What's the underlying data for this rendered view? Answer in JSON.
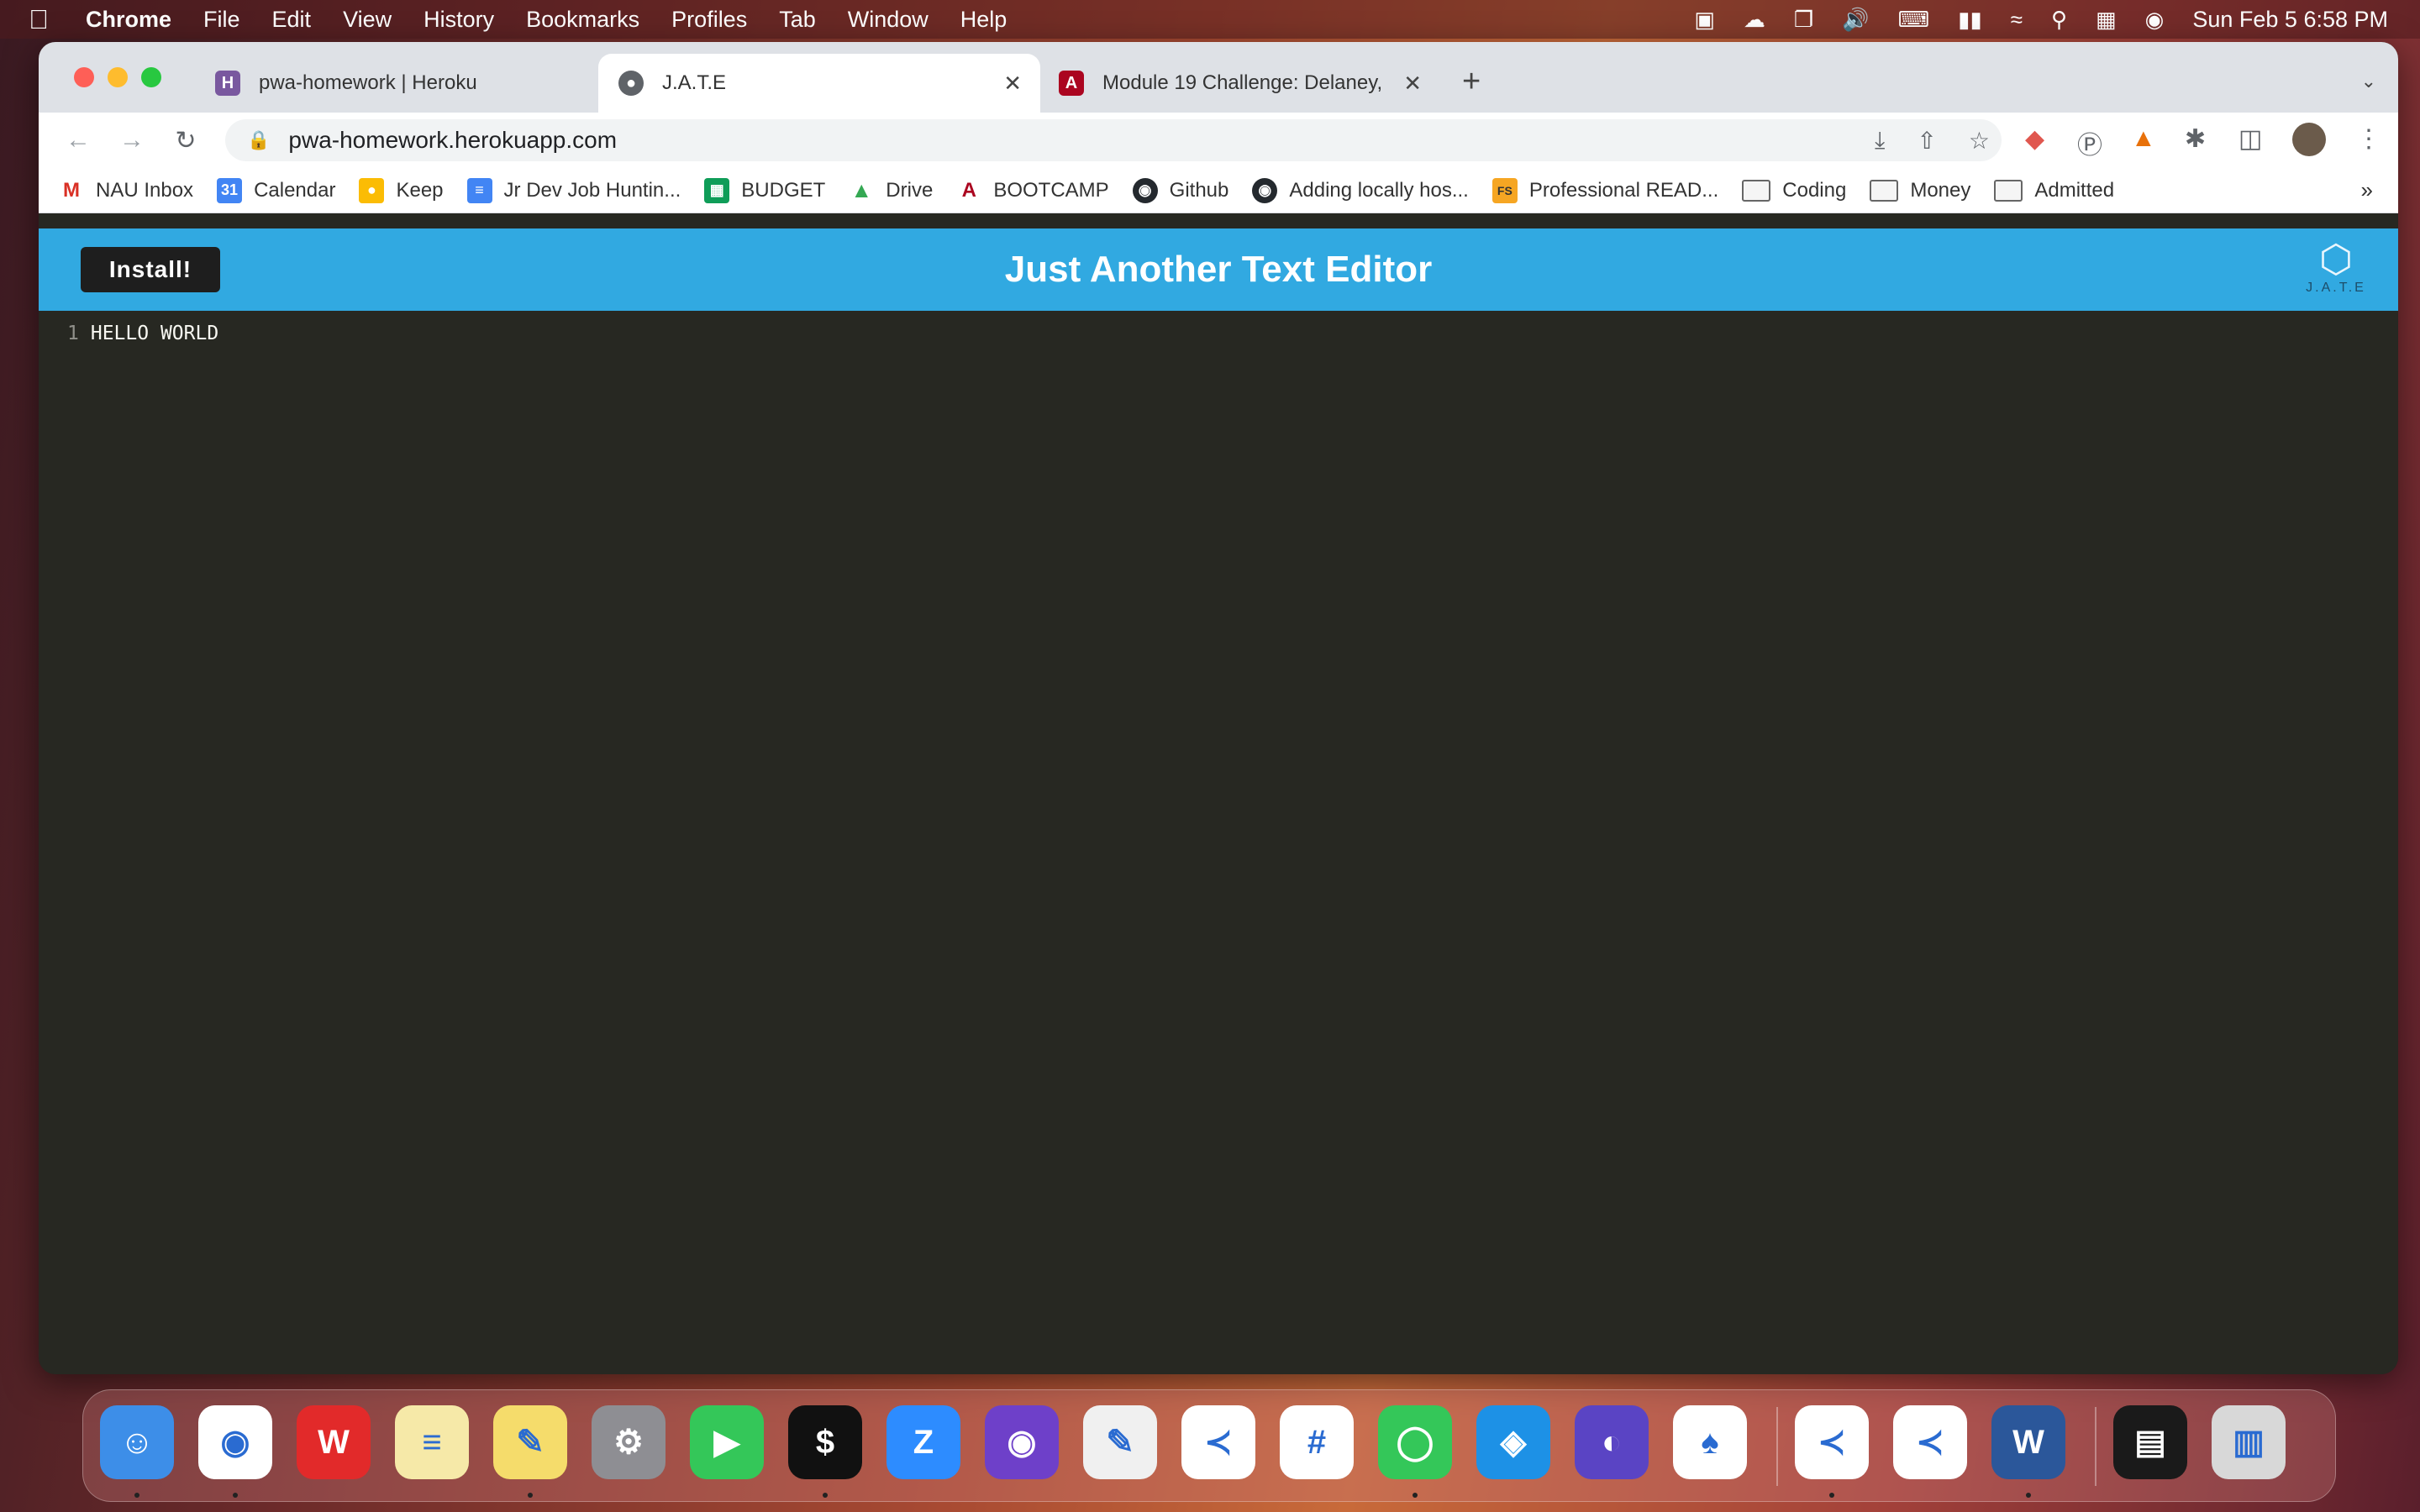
{
  "menubar": {
    "app": "Chrome",
    "items": [
      "File",
      "Edit",
      "View",
      "History",
      "Bookmarks",
      "Profiles",
      "Tab",
      "Window",
      "Help"
    ],
    "clock": "Sun Feb 5  6:58 PM"
  },
  "tabs": [
    {
      "title": "pwa-homework | Heroku",
      "icon": "heroku-icon"
    },
    {
      "title": "J.A.T.E",
      "icon": "globe-icon"
    },
    {
      "title": "Module 19 Challenge: Delaney,",
      "icon": "arizona-icon"
    }
  ],
  "address": {
    "url": "pwa-homework.herokuapp.com"
  },
  "bookmarks": [
    {
      "label": "NAU Inbox",
      "icon": "gmail-icon",
      "color": "#ffffff"
    },
    {
      "label": "Calendar",
      "icon": "calendar-icon",
      "color": "#4285f4"
    },
    {
      "label": "Keep",
      "icon": "keep-icon",
      "color": "#fbbc04"
    },
    {
      "label": "Jr Dev Job Huntin...",
      "icon": "docs-icon",
      "color": "#4285f4"
    },
    {
      "label": "BUDGET",
      "icon": "sheets-icon",
      "color": "#0f9d58"
    },
    {
      "label": "Drive",
      "icon": "drive-icon",
      "color": "#34a853"
    },
    {
      "label": "BOOTCAMP",
      "icon": "arizona-icon",
      "color": "#ab0520"
    },
    {
      "label": "Github",
      "icon": "github-icon",
      "color": "#24292e"
    },
    {
      "label": "Adding locally hos...",
      "icon": "github-icon",
      "color": "#24292e"
    },
    {
      "label": "Professional READ...",
      "icon": "fs-icon",
      "color": "#f6a623"
    },
    {
      "label": "Coding",
      "icon": "folder-icon",
      "color": ""
    },
    {
      "label": "Money",
      "icon": "folder-icon",
      "color": ""
    },
    {
      "label": "Admitted",
      "icon": "folder-icon",
      "color": ""
    }
  ],
  "app": {
    "install_label": "Install!",
    "title": "Just Another Text Editor",
    "logo_text": "J.A.T.E",
    "editor_line_number": "1",
    "editor_line_text": "HELLO WORLD"
  },
  "colors": {
    "header": "#31a9e1",
    "editor_bg": "#272822"
  },
  "dock": [
    {
      "name": "finder-icon",
      "color": "#3d8ee8"
    },
    {
      "name": "chrome-icon",
      "color": "#ffffff"
    },
    {
      "name": "wps-icon",
      "color": "#e22a2a"
    },
    {
      "name": "notes-icon",
      "color": "#f6e9a8"
    },
    {
      "name": "stickies-icon",
      "color": "#f5dc6b"
    },
    {
      "name": "system-preferences-icon",
      "color": "#8e8e93"
    },
    {
      "name": "facetime-icon",
      "color": "#34c759"
    },
    {
      "name": "terminal-icon",
      "color": "#111111"
    },
    {
      "name": "zoom-icon",
      "color": "#2d8cff"
    },
    {
      "name": "github-desktop-icon",
      "color": "#6e40c9"
    },
    {
      "name": "textedit-icon",
      "color": "#f0f0f0"
    },
    {
      "name": "vscode-icon",
      "color": "#ffffff"
    },
    {
      "name": "slack-icon",
      "color": "#ffffff"
    },
    {
      "name": "messages-icon",
      "color": "#34c759"
    },
    {
      "name": "docker-icon",
      "color": "#1d91e6"
    },
    {
      "name": "cleanshot-icon",
      "color": "#5a44c4"
    },
    {
      "name": "mongodb-compass-icon",
      "color": "#ffffff"
    },
    {
      "name": "vscode-icon",
      "color": "#ffffff"
    },
    {
      "name": "vscode-icon",
      "color": "#ffffff"
    },
    {
      "name": "word-icon",
      "color": "#2b579a"
    },
    {
      "name": "window-preview-icon",
      "color": "#1a1a1a"
    },
    {
      "name": "trash-icon",
      "color": "#d8d8d8"
    }
  ]
}
